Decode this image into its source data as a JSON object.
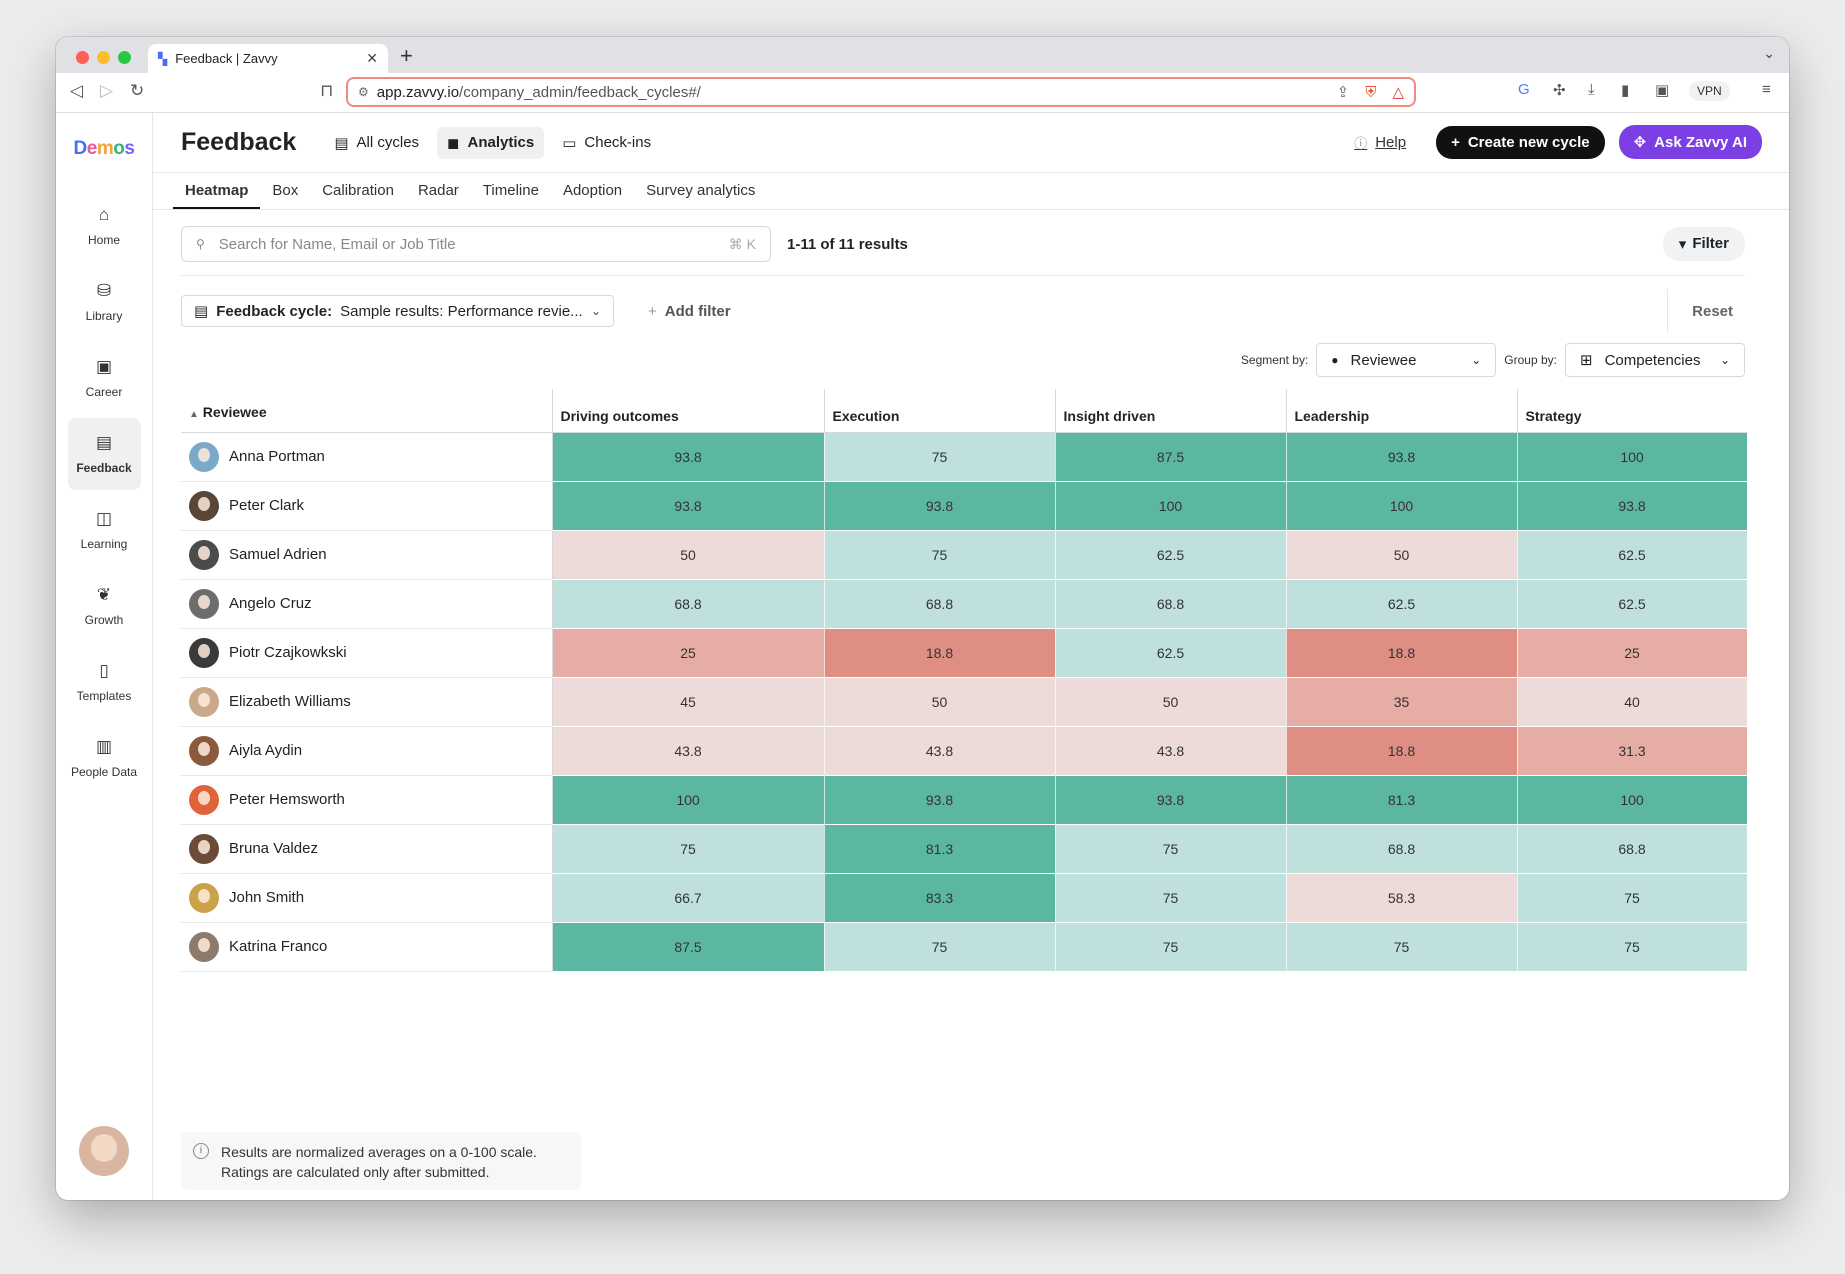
{
  "browser": {
    "tab_title": "Feedback | Zavvy",
    "url_host": "app.zavvy.io",
    "url_path": "/company_admin/feedback_cycles#/",
    "vpn_label": "VPN",
    "traffic_colors": [
      "#ff5f57",
      "#febc2e",
      "#28c840"
    ]
  },
  "sidebar": {
    "logo": "Demos",
    "items": [
      {
        "label": "Home",
        "icon": "home-icon"
      },
      {
        "label": "Library",
        "icon": "library-icon"
      },
      {
        "label": "Career",
        "icon": "career-icon"
      },
      {
        "label": "Feedback",
        "icon": "feedback-icon"
      },
      {
        "label": "Learning",
        "icon": "learning-icon"
      },
      {
        "label": "Growth",
        "icon": "growth-icon"
      },
      {
        "label": "Templates",
        "icon": "templates-icon"
      },
      {
        "label": "People Data",
        "icon": "people-data-icon"
      }
    ],
    "active": "Feedback"
  },
  "header": {
    "title": "Feedback",
    "nav": [
      "All cycles",
      "Analytics",
      "Check-ins"
    ],
    "active_nav": "Analytics",
    "help": "Help",
    "create_button": "Create new cycle",
    "ask_button": "Ask Zavvy AI",
    "accent_purple": "#7b3fe4"
  },
  "subtabs": [
    "Heatmap",
    "Box",
    "Calibration",
    "Radar",
    "Timeline",
    "Adoption",
    "Survey analytics"
  ],
  "active_subtab": "Heatmap",
  "search": {
    "placeholder": "Search for Name, Email or Job Title",
    "shortcut": "⌘ K",
    "results": "1-11 of 11 results",
    "filter_label": "Filter"
  },
  "filters": {
    "cycle_label": "Feedback cycle:",
    "cycle_value": "Sample results: Performance revie...",
    "add_filter": "Add filter",
    "reset": "Reset"
  },
  "segment": {
    "segment_label": "Segment by:",
    "segment_value": "Reviewee",
    "group_label": "Group by:",
    "group_value": "Competencies"
  },
  "table": {
    "name_header": "Reviewee",
    "columns": [
      "Driving outcomes",
      "Execution",
      "Insight driven",
      "Leadership",
      "Strategy"
    ],
    "rows": [
      {
        "name": "Anna Portman",
        "values": [
          "93.8",
          "75",
          "87.5",
          "93.8",
          "100"
        ]
      },
      {
        "name": "Peter Clark",
        "values": [
          "93.8",
          "93.8",
          "100",
          "100",
          "93.8"
        ]
      },
      {
        "name": "Samuel Adrien",
        "values": [
          "50",
          "75",
          "62.5",
          "50",
          "62.5"
        ]
      },
      {
        "name": "Angelo Cruz",
        "values": [
          "68.8",
          "68.8",
          "68.8",
          "62.5",
          "62.5"
        ]
      },
      {
        "name": "Piotr Czajkowkski",
        "values": [
          "25",
          "18.8",
          "62.5",
          "18.8",
          "25"
        ]
      },
      {
        "name": "Elizabeth Williams",
        "values": [
          "45",
          "50",
          "50",
          "35",
          "40"
        ]
      },
      {
        "name": "Aiyla Aydin",
        "values": [
          "43.8",
          "43.8",
          "43.8",
          "18.8",
          "31.3"
        ]
      },
      {
        "name": "Peter Hemsworth",
        "values": [
          "100",
          "93.8",
          "93.8",
          "81.3",
          "100"
        ]
      },
      {
        "name": "Bruna Valdez",
        "values": [
          "75",
          "81.3",
          "75",
          "68.8",
          "68.8"
        ]
      },
      {
        "name": "John Smith",
        "values": [
          "66.7",
          "83.3",
          "75",
          "58.3",
          "75"
        ]
      },
      {
        "name": "Katrina Franco",
        "values": [
          "87.5",
          "75",
          "75",
          "75",
          "75"
        ]
      }
    ],
    "colors": {
      "high": "#5bb7a1",
      "mid": "#bfe0dc",
      "low1": "#ecdbd9",
      "low2": "#e5ada6",
      "low3": "#df8e83"
    }
  },
  "note": {
    "line1": "Results are normalized averages on a 0-100 scale.",
    "line2": "Ratings are calculated only after submitted."
  }
}
